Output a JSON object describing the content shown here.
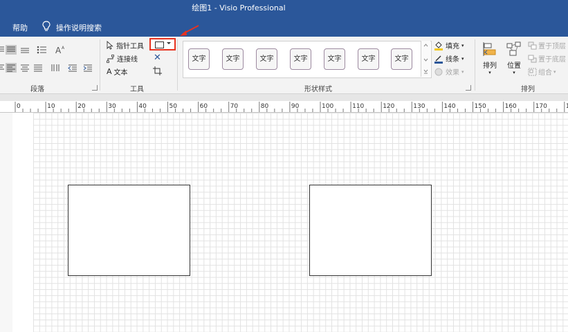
{
  "window": {
    "title": "绘图1  -  Visio Professional"
  },
  "menu": {
    "help": "帮助",
    "search": "操作说明搜索"
  },
  "ribbon": {
    "paragraph": {
      "label": "段落"
    },
    "tools": {
      "label": "工具",
      "pointer": "指针工具",
      "connector": "连接线",
      "text_glyph": "A",
      "text": "文本",
      "delete_glyph": "✕"
    },
    "shape_styles": {
      "label": "形状样式",
      "swatches": [
        "文字",
        "文字",
        "文字",
        "文字",
        "文字",
        "文字",
        "文字"
      ],
      "fill": "填充",
      "line": "线条",
      "effects": "效果"
    },
    "arrange": {
      "label": "排列",
      "arrange_btn": "排列",
      "position_btn": "位置",
      "bring_front": "置于顶层",
      "send_back": "置于底层",
      "group": "组合"
    }
  },
  "ruler": {
    "labels": [
      "0",
      "10",
      "20",
      "30",
      "40",
      "50",
      "60",
      "70",
      "80",
      "90",
      "100",
      "110",
      "120",
      "130",
      "140",
      "150",
      "160",
      "170",
      "180"
    ]
  },
  "colors": {
    "accent": "#2b579a",
    "highlight": "#e8321f"
  }
}
